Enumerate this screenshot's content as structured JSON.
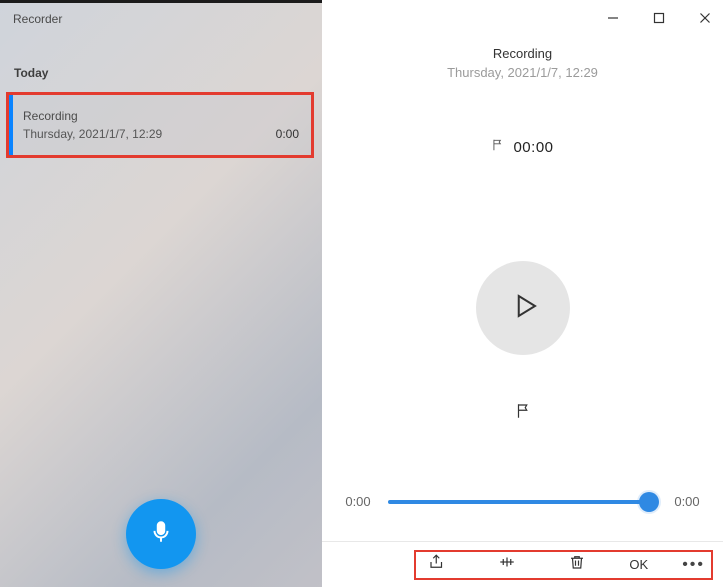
{
  "app": {
    "title": "Recorder"
  },
  "sidebar": {
    "section": "Today",
    "items": [
      {
        "title": "Recording",
        "date": "Thursday, 2021/1/7, 12:29",
        "duration": "0:00"
      }
    ]
  },
  "main": {
    "title": "Recording",
    "subtitle": "Thursday, 2021/1/7, 12:29",
    "marker_time": "00:00",
    "timeline": {
      "left": "0:00",
      "right": "0:00"
    },
    "ok_label": "OK"
  },
  "icons": {
    "mic": "mic-icon",
    "minimize": "minimize-icon",
    "maximize": "maximize-icon",
    "close": "close-icon",
    "flag": "flag-icon",
    "play": "play-icon",
    "share": "share-icon",
    "trim": "trim-icon",
    "trash": "trash-icon",
    "more": "more-icon"
  },
  "colors": {
    "accent": "#1296f0",
    "highlight": "#e33b2f",
    "slider": "#2f89e3"
  }
}
